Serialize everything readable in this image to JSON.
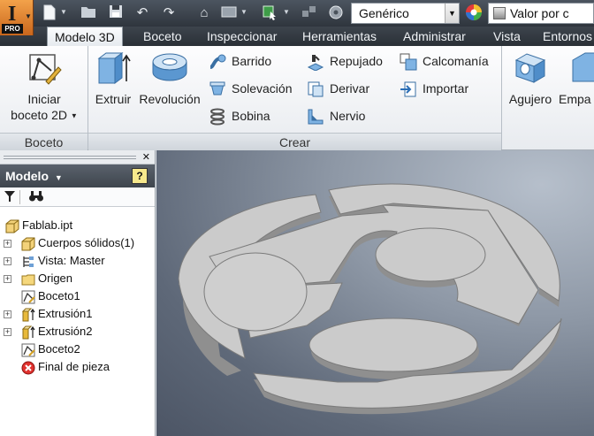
{
  "app": {
    "logo_letter": "I",
    "edition": "PRO"
  },
  "qat": {
    "icons": [
      "new-file-icon",
      "open-folder-icon",
      "save-icon",
      "undo-icon",
      "redo-icon",
      "home-icon",
      "update-icon",
      "select-icon",
      "measure-icon",
      "appearance-icon"
    ],
    "material_combo": "Genérico",
    "appearance_combo": "Valor por c"
  },
  "tabs": [
    {
      "label": "Modelo 3D",
      "active": true
    },
    {
      "label": "Boceto",
      "active": false
    },
    {
      "label": "Inspeccionar",
      "active": false
    },
    {
      "label": "Herramientas",
      "active": false
    },
    {
      "label": "Administrar",
      "active": false
    },
    {
      "label": "Vista",
      "active": false
    },
    {
      "label": "Entornos",
      "active": false
    }
  ],
  "ribbon": {
    "boceto_panel": {
      "title": "Boceto",
      "start_sketch_line1": "Iniciar",
      "start_sketch_line2": "boceto 2D"
    },
    "crear_panel": {
      "title": "Crear",
      "extrude": "Extruir",
      "revolve": "Revolución",
      "sweep": "Barrido",
      "loft": "Solevación",
      "coil": "Bobina",
      "emboss": "Repujado",
      "derive": "Derivar",
      "rib": "Nervio",
      "decal": "Calcomanía",
      "import": "Importar"
    },
    "modify_panel": {
      "hole": "Agujero",
      "fillet_partial": "Empa"
    }
  },
  "browser": {
    "title": "Modelo",
    "help_glyph": "?",
    "tree": [
      {
        "label": "Fablab.ipt",
        "icon": "part-file-icon",
        "expandable": false
      },
      {
        "label": "Cuerpos sólidos(1)",
        "icon": "solid-bodies-icon",
        "expandable": true
      },
      {
        "label": "Vista: Master",
        "icon": "view-rep-icon",
        "expandable": true
      },
      {
        "label": "Origen",
        "icon": "folder-icon",
        "expandable": true
      },
      {
        "label": "Boceto1",
        "icon": "sketch-icon",
        "expandable": false
      },
      {
        "label": "Extrusión1",
        "icon": "extrusion-icon",
        "expandable": true
      },
      {
        "label": "Extrusión2",
        "icon": "extrusion-icon",
        "expandable": true
      },
      {
        "label": "Boceto2",
        "icon": "sketch-icon",
        "expandable": false
      },
      {
        "label": "Final de pieza",
        "icon": "end-of-part-icon",
        "expandable": false
      }
    ]
  },
  "viewport": {
    "model": "fablab-logo-extrusion",
    "face_color": "#cbcbcb",
    "side_color": "#8f8f8f"
  }
}
